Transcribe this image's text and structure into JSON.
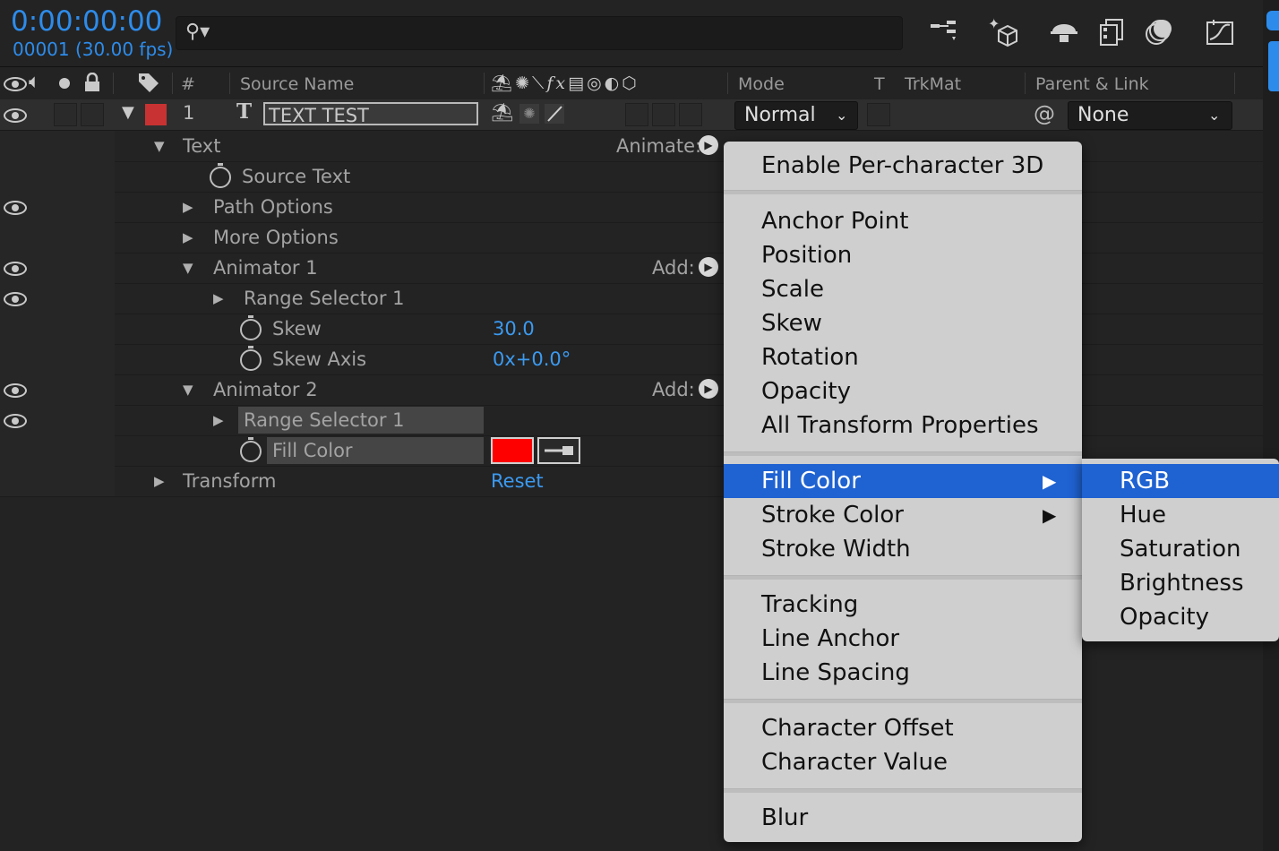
{
  "timecode": "0:00:00:00",
  "frames": "00001 (30.00 fps)",
  "search": {
    "placeholder": ""
  },
  "columns": {
    "hash": "#",
    "source_name": "Source Name",
    "mode": "Mode",
    "t": "T",
    "trkmat": "TrkMat",
    "parent_link": "Parent & Link"
  },
  "layer": {
    "number": "1",
    "type_glyph": "T",
    "name": "TEXT TEST",
    "label_color": "#c83232",
    "mode": "Normal",
    "parent": "None"
  },
  "properties": {
    "text": "Text",
    "animate_label": "Animate:",
    "source_text": "Source Text",
    "path_options": "Path Options",
    "more_options": "More Options",
    "animator1": "Animator 1",
    "add_label": "Add:",
    "range_selector1": "Range Selector 1",
    "skew": "Skew",
    "skew_value": "30.0",
    "skew_axis": "Skew Axis",
    "skew_axis_value": "0x+0.0°",
    "animator2": "Animator 2",
    "add_label2": "Add:",
    "range_selector1b": "Range Selector 1",
    "fill_color": "Fill Color",
    "fill_color_value": "#ff0000",
    "transform": "Transform",
    "reset": "Reset"
  },
  "menu": {
    "items": [
      "Enable Per-character 3D",
      "Anchor Point",
      "Position",
      "Scale",
      "Skew",
      "Rotation",
      "Opacity",
      "All Transform Properties",
      "Fill Color",
      "Stroke Color",
      "Stroke Width",
      "Tracking",
      "Line Anchor",
      "Line Spacing",
      "Character Offset",
      "Character Value",
      "Blur"
    ],
    "selected": "Fill Color"
  },
  "submenu": {
    "items": [
      "RGB",
      "Hue",
      "Saturation",
      "Brightness",
      "Opacity"
    ],
    "selected": "RGB"
  },
  "colors": {
    "accent_blue": "#2d8ceb",
    "menu_highlight": "#1f62d1",
    "fill_swatch": "#ff0000"
  }
}
